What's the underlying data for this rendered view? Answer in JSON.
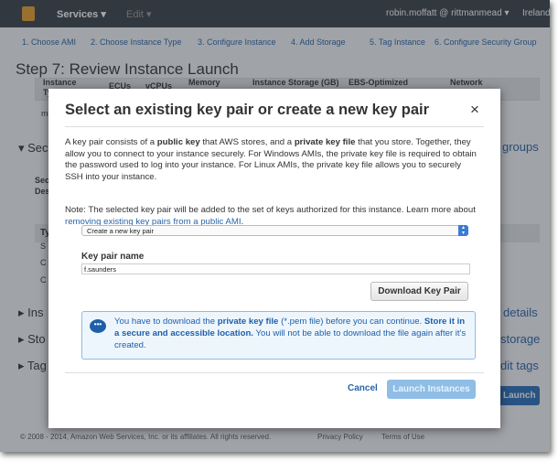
{
  "topbar": {
    "services": "Services ▾",
    "edit": "Edit ▾",
    "user": "robin.moffatt @ rittmanmead ▾",
    "region": "Ireland"
  },
  "steps": [
    "1. Choose AMI",
    "2. Choose Instance Type",
    "3. Configure Instance",
    "4. Add Storage",
    "5. Tag Instance",
    "6. Configure Security Group"
  ],
  "page_title": "Step 7: Review Instance Launch",
  "table_headers": [
    "Instance Type",
    "ECUs",
    "vCPUs",
    "Memory (GiB)",
    "Instance Storage (GB)",
    "EBS-Optimized Available",
    "Network Performance"
  ],
  "background": {
    "sec": "Sec",
    "groups": "groups",
    "sec2": "Sec",
    "des": "Des",
    "ty": "Ty",
    "rows": [
      "S",
      "C",
      "C"
    ],
    "m": "m",
    "ins": "Ins",
    "details": "details",
    "sto": "Sto",
    "storage": "storage",
    "tag": "Tag",
    "edit_tags": "dit tags",
    "launch": "Launch"
  },
  "footer": {
    "copyright": "© 2008 - 2014, Amazon Web Services, Inc. or its affiliates. All rights reserved.",
    "privacy": "Privacy Policy",
    "terms": "Terms of Use"
  },
  "modal": {
    "title": "Select an existing key pair or create a new key pair",
    "close": "×",
    "p1": [
      "A key pair consists of a ",
      "public key",
      " that AWS stores, and a ",
      "private key file",
      " that you store. Together, they allow you to connect to your instance securely. For Windows AMIs, the private key file is required to obtain the password used to log into your instance. For Linux AMIs, the private key file allows you to securely SSH into your instance."
    ],
    "note": "Note: The selected key pair will be added to the set of keys authorized for this instance. Learn more about ",
    "note_link": "removing existing key pairs from a public AMI",
    "note_end": ".",
    "select_value": "Create a new key pair",
    "key_label": "Key pair name",
    "key_value": "f.saunders",
    "download": "Download Key Pair",
    "info": [
      "You have to download the ",
      "private key file",
      " (*.pem file) before you can continue. ",
      "Store it in a secure and accessible location.",
      " You will not be able to download the file again after it's created."
    ],
    "cancel": "Cancel",
    "launch": "Launch Instances"
  }
}
